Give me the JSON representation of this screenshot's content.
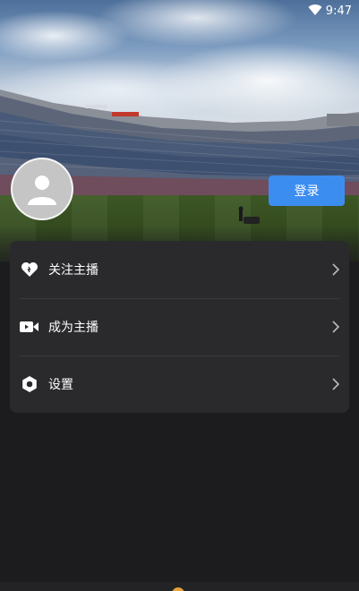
{
  "status_bar": {
    "time": "9:47"
  },
  "header": {
    "login_label": "登录"
  },
  "menu": {
    "items": [
      {
        "label": "关注主播",
        "icon": "heart-icon"
      },
      {
        "label": "成为主播",
        "icon": "video-camera-icon"
      },
      {
        "label": "设置",
        "icon": "gear-icon"
      }
    ]
  },
  "colors": {
    "accent": "#3b8df0",
    "background": "#1c1c1e",
    "card": "#2a2a2d"
  }
}
